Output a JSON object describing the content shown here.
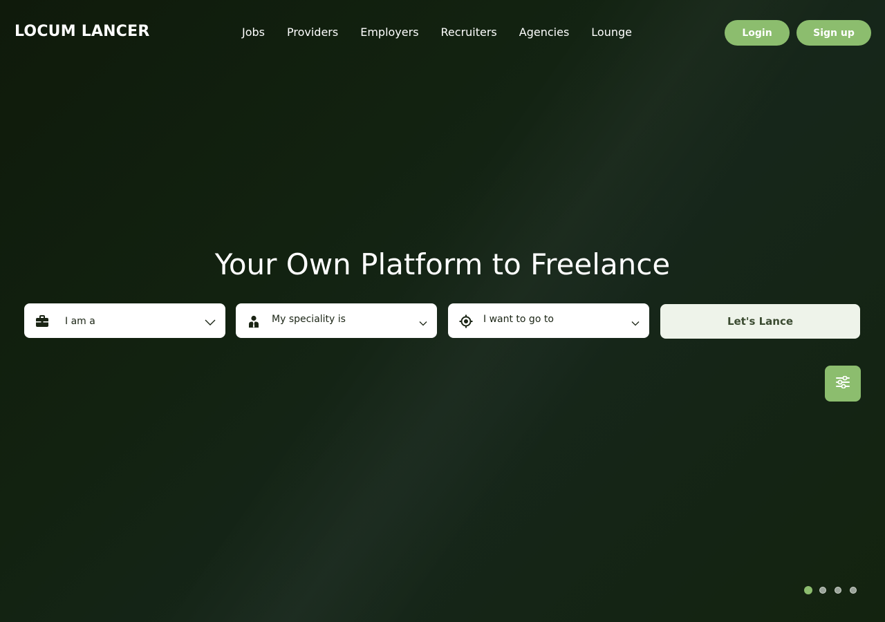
{
  "header": {
    "logo": "LOCUM LANCER",
    "nav": [
      "Jobs",
      "Providers",
      "Employers",
      "Recruiters",
      "Agencies",
      "Lounge"
    ],
    "login_label": "Login",
    "signup_label": "Sign up"
  },
  "hero": {
    "title": "Your Own Platform to Freelance",
    "selects": [
      {
        "label": "I am a",
        "icon": "briefcase-icon"
      },
      {
        "label": "My speciality is",
        "icon": "doctor-icon"
      },
      {
        "label": "I want to go to",
        "icon": "location-target-icon"
      }
    ],
    "cta_label": "Let's Lance",
    "filter_icon": "sliders-icon"
  },
  "carousel": {
    "slide_count": 4,
    "active_index": 0
  },
  "colors": {
    "accent": "#8cbd6e",
    "background": "#122210",
    "cta_bg": "#eef3ea"
  }
}
